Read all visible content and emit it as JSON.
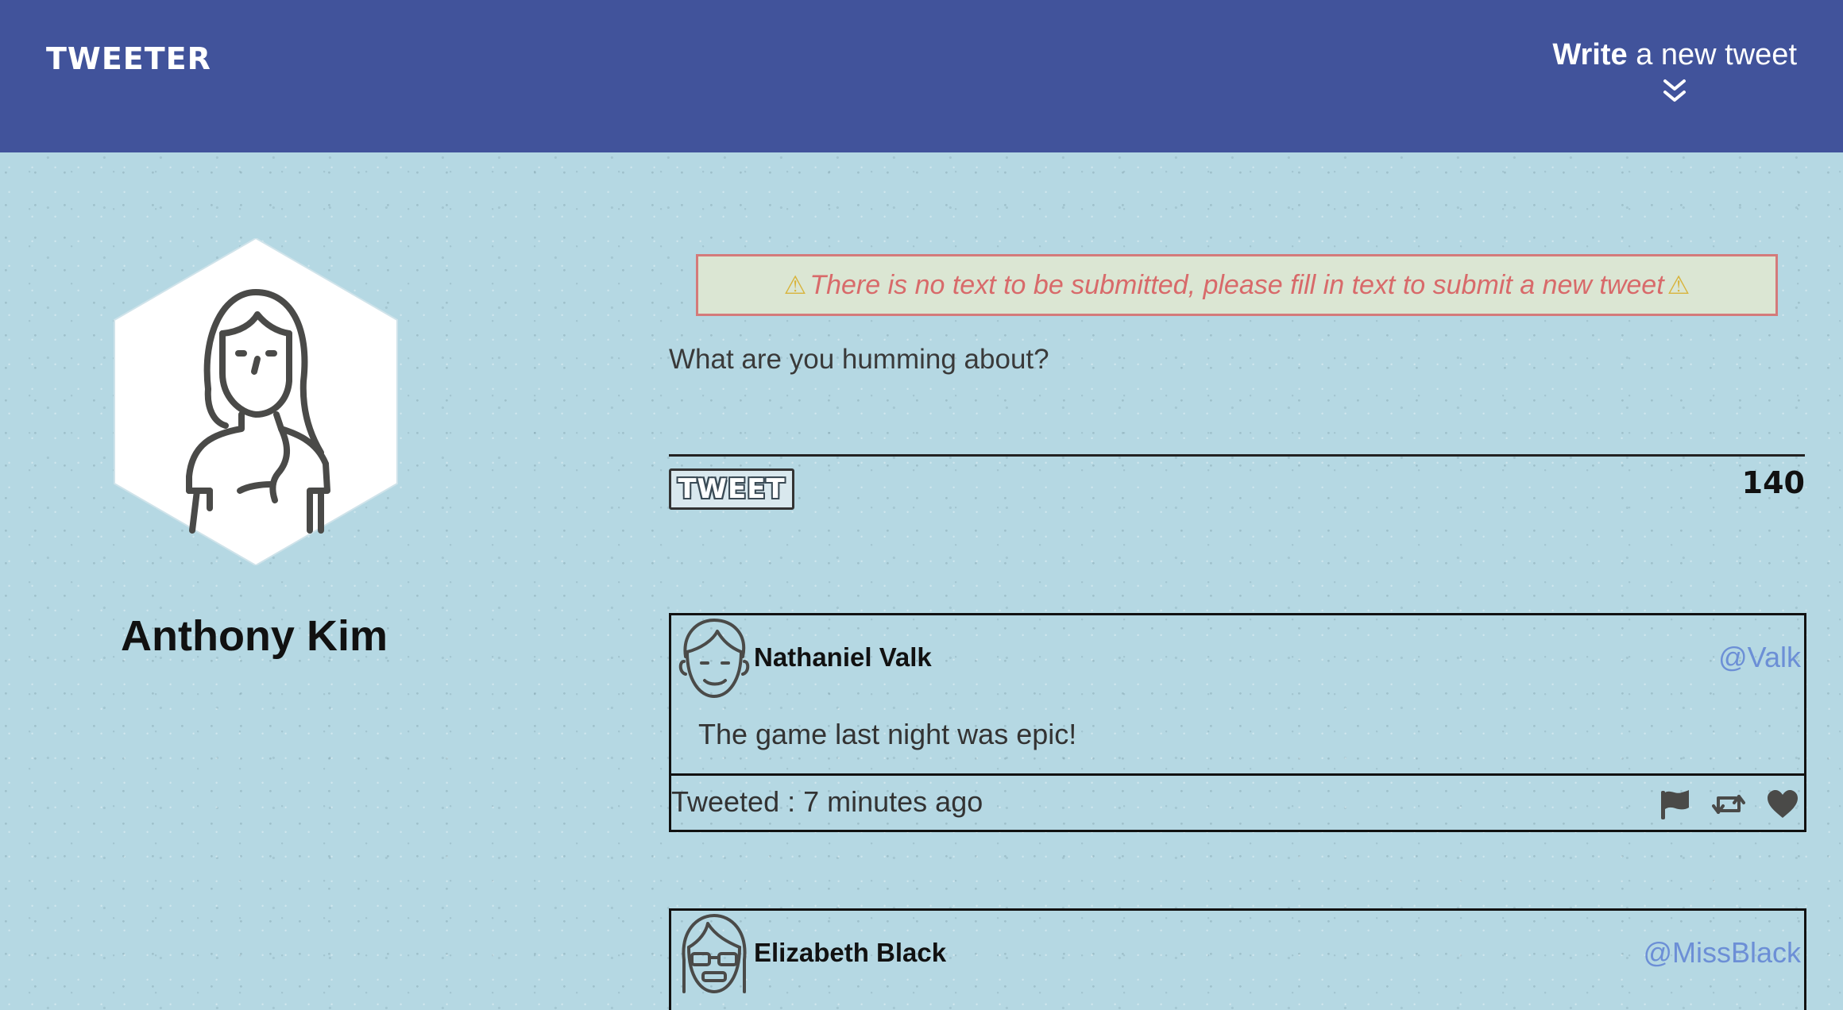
{
  "nav": {
    "brand": "TWEETER",
    "compose_bold": "Write",
    "compose_rest": " a new tweet",
    "bg_color": "#41539b"
  },
  "profile": {
    "name": "Anthony Kim",
    "avatar_icon": "woman-avatar-icon"
  },
  "composer": {
    "error": "There is no text to be submitted, please fill in text to submit a new tweet",
    "placeholder": "What are you humming about?",
    "button_label": "TWEET",
    "char_count": "140"
  },
  "tweets": [
    {
      "name": "Nathaniel Valk",
      "handle": "@Valk",
      "content": "The game last night was epic!",
      "time": "Tweeted : 7 minutes ago",
      "avatar_icon": "man-avatar-icon"
    },
    {
      "name": "Elizabeth Black",
      "handle": "@MissBlack",
      "avatar_icon": "woman-glasses-avatar-icon"
    }
  ],
  "colors": {
    "page_bg": "#b5d8e3",
    "handle": "#6c8fd6",
    "error_text": "#d86a6a",
    "error_bg": "#dbe6d3"
  }
}
